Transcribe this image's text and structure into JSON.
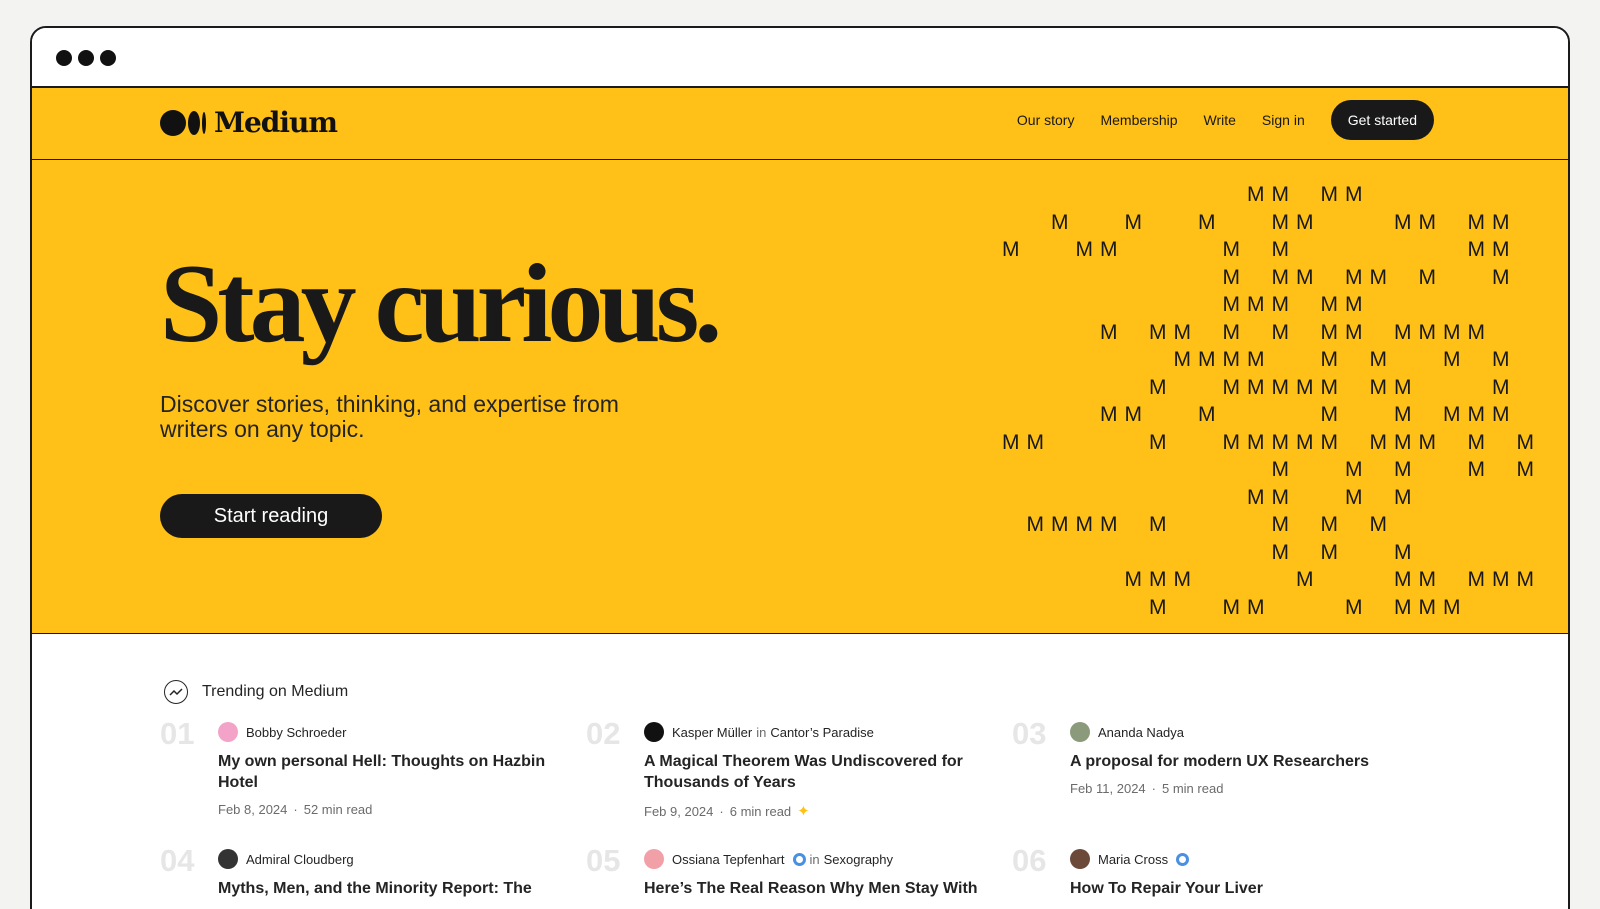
{
  "header": {
    "logo_text": "Medium",
    "nav": [
      "Our story",
      "Membership",
      "Write",
      "Sign in"
    ],
    "cta": "Get started",
    "brand_color": "#ffc017"
  },
  "hero": {
    "title": "Stay curious.",
    "subtitle": "Discover stories, thinking, and expertise from writers on any topic.",
    "cta": "Start reading",
    "pattern_glyph": "M"
  },
  "trending": {
    "title": "Trending on Medium",
    "icon": "trending-icon",
    "items": [
      {
        "num": "01",
        "author": "Bobby Schroeder",
        "publication": "",
        "verified": false,
        "title": "My own personal Hell: Thoughts on Hazbin Hotel",
        "date": "Feb 8, 2024",
        "read": "52 min read",
        "member": false,
        "avatar_color": "#f4a3c8"
      },
      {
        "num": "02",
        "author": "Kasper Müller",
        "publication": "Cantor’s Paradise",
        "verified": false,
        "title": "A Magical Theorem Was Undiscovered for Thousands of Years",
        "date": "Feb 9, 2024",
        "read": "6 min read",
        "member": true,
        "avatar_color": "#111111"
      },
      {
        "num": "03",
        "author": "Ananda Nadya",
        "publication": "",
        "verified": false,
        "title": "A proposal for modern UX Researchers",
        "date": "Feb 11, 2024",
        "read": "5 min read",
        "member": false,
        "avatar_color": "#8a9a7a"
      },
      {
        "num": "04",
        "author": "Admiral Cloudberg",
        "publication": "",
        "verified": false,
        "title": "Myths, Men, and the Minority Report: The",
        "date": "",
        "read": "",
        "member": false,
        "avatar_color": "#333333"
      },
      {
        "num": "05",
        "author": "Ossiana Tepfenhart",
        "publication": "Sexography",
        "verified": true,
        "title": "Here’s The Real Reason Why Men Stay With",
        "date": "",
        "read": "",
        "member": false,
        "avatar_color": "#f2a0a8"
      },
      {
        "num": "06",
        "author": "Maria Cross",
        "publication": "",
        "verified": true,
        "title": "How To Repair Your Liver",
        "date": "",
        "read": "",
        "member": false,
        "avatar_color": "#6b4a3a"
      }
    ],
    "in_word": "in",
    "dot_separator": "·"
  }
}
